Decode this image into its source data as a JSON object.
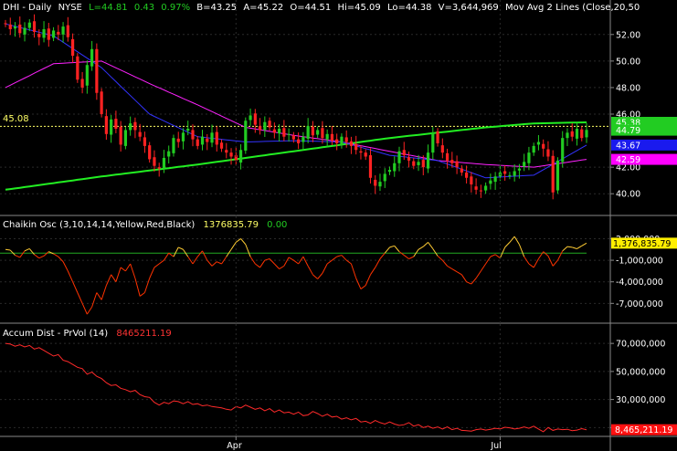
{
  "chart_data": [
    {
      "type": "candlestick",
      "header": {
        "symbol": "DHI - Daily",
        "exchange": "NYSE",
        "last": "L=44.81",
        "change": "0.43",
        "change_pct": "0.97%",
        "bid": "B=43.25",
        "ask": "A=45.22",
        "open": "O=44.51",
        "high": "Hi=45.09",
        "low": "Lo=44.38",
        "volume": "V=3,644,969",
        "study": "Mov Avg 2 Lines (Close,20,50"
      },
      "y_ticks": [
        "52.00",
        "50.00",
        "48.00",
        "46.00",
        "42.00",
        "40.00"
      ],
      "ylim": [
        38.5,
        53.5
      ],
      "price_line": {
        "label": "45.08",
        "value": 45.08
      },
      "price_tags": [
        {
          "label": "45.38",
          "value": 45.38,
          "color": "#22cc22"
        },
        {
          "label": "44.79",
          "value": 44.79,
          "color": "#22cc22"
        },
        {
          "label": "43.67",
          "value": 43.67,
          "color": "#1a1aee"
        },
        {
          "label": "42.59",
          "value": 42.59,
          "color": "#ff00ff"
        }
      ],
      "x_labels": [
        "Apr",
        "Jul"
      ],
      "n_days": 122,
      "x_label_days": [
        48,
        103
      ],
      "colors": {
        "up": "#22cc22",
        "down": "#ff2222",
        "ma20": "#3333ff",
        "ma50": "#ff22ff",
        "ma200": "#22ee22",
        "price_line": "#ffff66"
      },
      "candles_close": [
        52.8,
        52.4,
        52.6,
        52.1,
        52.5,
        52.9,
        52.2,
        51.8,
        52.4,
        51.6,
        52.3,
        52.0,
        52.6,
        51.8,
        50.4,
        48.6,
        48.0,
        49.7,
        50.9,
        47.6,
        46.0,
        44.5,
        45.6,
        44.9,
        43.7,
        44.8,
        45.3,
        44.8,
        44.3,
        43.6,
        42.6,
        42.1,
        41.9,
        42.7,
        43.2,
        44.2,
        43.9,
        44.6,
        44.9,
        44.1,
        43.6,
        44.3,
        43.9,
        44.6,
        43.7,
        43.4,
        43.1,
        42.8,
        42.5,
        43.3,
        45.5,
        45.9,
        45.2,
        44.8,
        45.4,
        45.0,
        44.6,
        44.9,
        44.3,
        44.5,
        44.1,
        43.8,
        44.3,
        45.1,
        44.4,
        44.8,
        44.2,
        44.5,
        44.0,
        43.8,
        44.3,
        43.9,
        43.6,
        43.3,
        43.1,
        42.8,
        41.2,
        40.6,
        40.9,
        41.5,
        41.8,
        42.3,
        43.2,
        42.9,
        42.5,
        42.1,
        42.4,
        42.0,
        43.1,
        44.6,
        43.8,
        43.1,
        42.5,
        42.3,
        42.0,
        41.6,
        41.2,
        40.7,
        40.3,
        40.2,
        40.6,
        41.0,
        41.3,
        41.6,
        41.5,
        41.4,
        41.7,
        41.9,
        42.4,
        43.1,
        43.6,
        43.9,
        43.4,
        42.8,
        40.1,
        42.5,
        44.2,
        44.6,
        44.3,
        44.9,
        44.2,
        44.81
      ],
      "ma_20": {
        "x": [
          0,
          10,
          20,
          30,
          40,
          50,
          60,
          70,
          80,
          90,
          100,
          110,
          121
        ],
        "values": [
          52.8,
          51.9,
          49.5,
          46.0,
          44.3,
          43.9,
          44.0,
          43.9,
          42.9,
          42.5,
          41.2,
          41.4,
          43.67
        ]
      },
      "ma_50": {
        "x": [
          0,
          10,
          20,
          30,
          40,
          50,
          60,
          70,
          80,
          90,
          100,
          110,
          121
        ],
        "values": [
          48.0,
          49.8,
          50.0,
          48.3,
          46.7,
          45.0,
          44.4,
          43.9,
          43.2,
          42.5,
          42.2,
          42.0,
          42.59
        ]
      },
      "ma_200": {
        "x": [
          0,
          20,
          40,
          60,
          80,
          100,
          110,
          121
        ],
        "values": [
          40.3,
          41.3,
          42.2,
          43.2,
          44.2,
          45.0,
          45.3,
          45.38
        ]
      }
    },
    {
      "type": "line",
      "title": "Chaikin Osc (3,10,14,14,Yellow,Red,Black)",
      "value_label": "1376835.79",
      "signal_label": "0.00",
      "y_ticks": [
        "2,000,000",
        "-1,000,000",
        "-4,000,000",
        "-7,000,000"
      ],
      "ylim": [
        -9500000,
        3200000
      ],
      "tag": "1,376,835.79",
      "tag_value": 1376835.79,
      "zero_line": 0,
      "series": {
        "name": "Chaikin Osc",
        "values": [
          500000,
          400000,
          -300000,
          -600000,
          300000,
          600000,
          -200000,
          -700000,
          -400000,
          200000,
          -100000,
          -500000,
          -1200000,
          -2500000,
          -4000000,
          -5500000,
          -7000000,
          -8500000,
          -7500000,
          -5500000,
          -6500000,
          -4500000,
          -3000000,
          -4000000,
          -2000000,
          -2500000,
          -1500000,
          -3500000,
          -6000000,
          -5500000,
          -3500000,
          -2000000,
          -1500000,
          -1000000,
          0,
          -500000,
          800000,
          500000,
          -500000,
          -1500000,
          -500000,
          300000,
          -1000000,
          -1800000,
          -1200000,
          -1500000,
          -500000,
          500000,
          1500000,
          2000000,
          1200000,
          -500000,
          -1500000,
          -2000000,
          -1000000,
          -800000,
          -1500000,
          -2200000,
          -1800000,
          -600000,
          -1000000,
          -1500000,
          -500000,
          -1800000,
          -3000000,
          -3600000,
          -2800000,
          -1500000,
          -1000000,
          -500000,
          -300000,
          -1000000,
          -1500000,
          -3500000,
          -5000000,
          -4500000,
          -3000000,
          -2000000,
          -800000,
          0,
          800000,
          1000000,
          200000,
          -300000,
          -800000,
          -500000,
          500000,
          900000,
          1500000,
          600000,
          -400000,
          -1000000,
          -1800000,
          -2200000,
          -2600000,
          -3000000,
          -4000000,
          -4300000,
          -3500000,
          -2500000,
          -1500000,
          -500000,
          -200000,
          -700000,
          800000,
          1500000,
          2300000,
          1200000,
          -500000,
          -1500000,
          -2000000,
          -800000,
          200000,
          -400000,
          -1800000,
          -1000000,
          300000,
          900000,
          800000,
          600000,
          1000000,
          1376835.79
        ]
      }
    },
    {
      "type": "line",
      "title": "Accum Dist - PrVol (14)",
      "value_label": "8465211.19",
      "y_ticks": [
        "70,000,000",
        "50,000,000",
        "30,000,000",
        "10,000,000"
      ],
      "ylim": [
        5000000,
        74000000
      ],
      "tag": "8,465,211.19",
      "tag_value": 8465211.19,
      "series": {
        "name": "Accum Dist - PrVol",
        "values": [
          70000000,
          69500000,
          68000000,
          69000000,
          67500000,
          68500000,
          66000000,
          67000000,
          65000000,
          63000000,
          61000000,
          62000000,
          58000000,
          57000000,
          55000000,
          53000000,
          52000000,
          48000000,
          49500000,
          46500000,
          45000000,
          42000000,
          40000000,
          40500000,
          38000000,
          37000000,
          35500000,
          36500000,
          33500000,
          32000000,
          31500000,
          28000000,
          26000000,
          28000000,
          27000000,
          29000000,
          28500000,
          27000000,
          28500000,
          26500000,
          27000000,
          25500000,
          26000000,
          25000000,
          24500000,
          24000000,
          23000000,
          22500000,
          25000000,
          24000000,
          26000000,
          24500000,
          23000000,
          24000000,
          22000000,
          23500000,
          21000000,
          22500000,
          20500000,
          21000000,
          19500000,
          21000000,
          18500000,
          19000000,
          21500000,
          20000000,
          18000000,
          19500000,
          17500000,
          18000000,
          16000000,
          17000000,
          15500000,
          16500000,
          14000000,
          14500000,
          13000000,
          15000000,
          13500000,
          12500000,
          14000000,
          12500000,
          11500000,
          12000000,
          13500000,
          11000000,
          12000000,
          10000000,
          11000000,
          9500000,
          10500000,
          9000000,
          10500000,
          8500000,
          9500000,
          8000000,
          7800000,
          7500000,
          8500000,
          9000000,
          8200000,
          8800000,
          9500000,
          9000000,
          10200000,
          9800000,
          9000000,
          9500000,
          10500000,
          9500000,
          11000000,
          9000000,
          7000000,
          10000000,
          8000000,
          9000000,
          8500000,
          8800000,
          7800000,
          8200000,
          9200000,
          8465211.19
        ]
      }
    }
  ]
}
